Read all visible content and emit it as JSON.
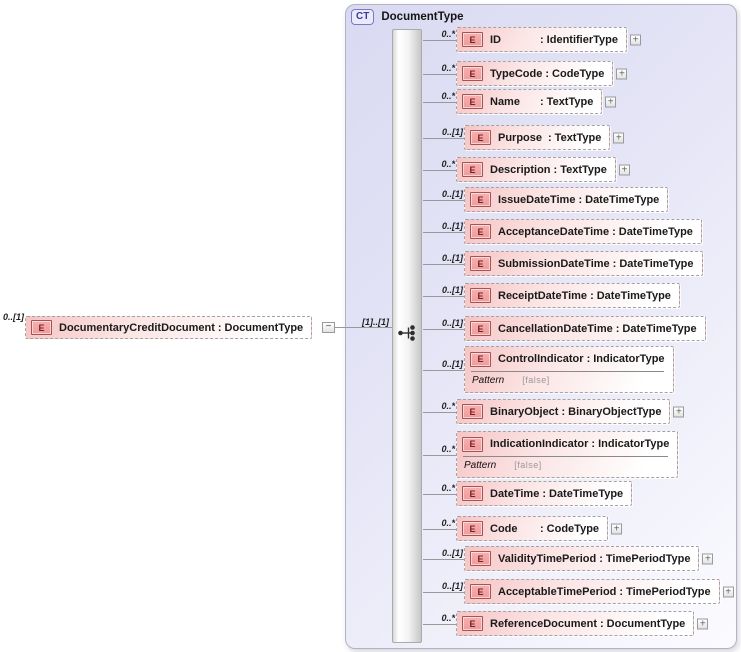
{
  "icons": {
    "element_badge": "E",
    "complex_type_badge": "CT",
    "expand_glyph": "+",
    "collapse_glyph": "−",
    "type_separator": ":"
  },
  "root": {
    "cardinality": "0..[1]",
    "name": "DocumentaryCreditDocument",
    "type": "DocumentType"
  },
  "link": {
    "cardinality": "[1]..[1]"
  },
  "complex_type": {
    "title": "DocumentType",
    "children": [
      {
        "cardinality": "0..*",
        "name": "ID",
        "type": "IdentifierType",
        "expandable": true
      },
      {
        "cardinality": "0..*",
        "name": "TypeCode",
        "type": "CodeType",
        "expandable": true
      },
      {
        "cardinality": "0..*",
        "name": "Name",
        "type": "TextType",
        "expandable": true
      },
      {
        "cardinality": "0..[1]",
        "name": "Purpose",
        "type": "TextType",
        "expandable": true
      },
      {
        "cardinality": "0..*",
        "name": "Description",
        "type": "TextType",
        "expandable": true
      },
      {
        "cardinality": "0..[1]",
        "name": "IssueDateTime",
        "type": "DateTimeType",
        "expandable": false
      },
      {
        "cardinality": "0..[1]",
        "name": "AcceptanceDateTime",
        "type": "DateTimeType",
        "expandable": false
      },
      {
        "cardinality": "0..[1]",
        "name": "SubmissionDateTime",
        "type": "DateTimeType",
        "expandable": false
      },
      {
        "cardinality": "0..[1]",
        "name": "ReceiptDateTime",
        "type": "DateTimeType",
        "expandable": false
      },
      {
        "cardinality": "0..[1]",
        "name": "CancellationDateTime",
        "type": "DateTimeType",
        "expandable": false
      },
      {
        "cardinality": "0..[1]",
        "name": "ControlIndicator",
        "type": "IndicatorType",
        "expandable": false,
        "facet": {
          "label": "Pattern",
          "value": "[false]"
        }
      },
      {
        "cardinality": "0..*",
        "name": "BinaryObject",
        "type": "BinaryObjectType",
        "expandable": true
      },
      {
        "cardinality": "0..*",
        "name": "IndicationIndicator",
        "type": "IndicatorType",
        "expandable": false,
        "facet": {
          "label": "Pattern",
          "value": "[false]"
        }
      },
      {
        "cardinality": "0..*",
        "name": "DateTime",
        "type": "DateTimeType",
        "expandable": false
      },
      {
        "cardinality": "0..*",
        "name": "Code",
        "type": "CodeType",
        "expandable": true
      },
      {
        "cardinality": "0..[1]",
        "name": "ValidityTimePeriod",
        "type": "TimePeriodType",
        "expandable": true
      },
      {
        "cardinality": "0..[1]",
        "name": "AcceptableTimePeriod",
        "type": "TimePeriodType",
        "expandable": true
      },
      {
        "cardinality": "0..*",
        "name": "ReferenceDocument",
        "type": "DocumentType",
        "expandable": true
      }
    ]
  }
}
